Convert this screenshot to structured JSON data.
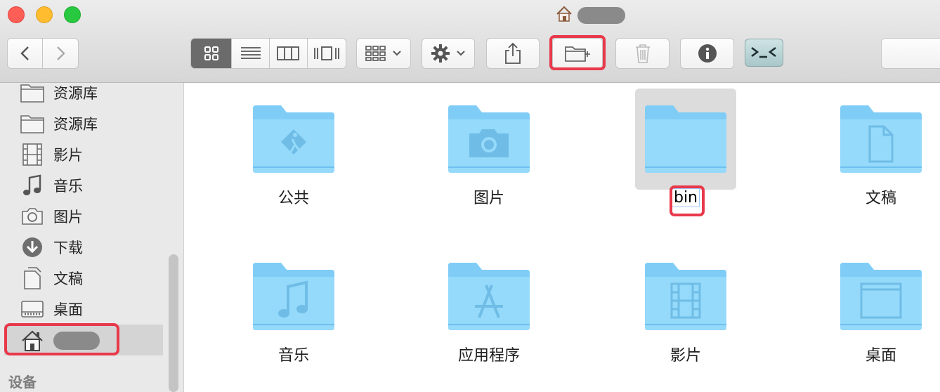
{
  "window": {
    "title_icon": "home-icon"
  },
  "toolbar": {
    "back_icon": "chevron-left-icon",
    "forward_icon": "chevron-right-icon",
    "view_modes": [
      "icon-view",
      "list-view",
      "column-view",
      "cover-flow-view"
    ],
    "active_view": "icon-view",
    "buttons": [
      "arrange-menu",
      "action-gear-menu",
      "share",
      "new-folder",
      "delete",
      "get-info",
      "terminal"
    ],
    "highlight_color": "#e8394b"
  },
  "sidebar": {
    "items": [
      {
        "label": "资源库",
        "icon": "folder-icon"
      },
      {
        "label": "资源库",
        "icon": "folder-icon"
      },
      {
        "label": "影片",
        "icon": "film-icon"
      },
      {
        "label": "音乐",
        "icon": "music-note-icon"
      },
      {
        "label": "图片",
        "icon": "camera-icon"
      },
      {
        "label": "下载",
        "icon": "download-icon"
      },
      {
        "label": "文稿",
        "icon": "document-icon"
      },
      {
        "label": "桌面",
        "icon": "desktop-icon"
      }
    ],
    "selected_icon": "home-icon",
    "section_devices": "设备"
  },
  "content": {
    "items": [
      {
        "label": "公共",
        "icon": "public-folder-icon"
      },
      {
        "label": "图片",
        "icon": "pictures-folder-icon"
      },
      {
        "label": "bin",
        "icon": "folder-icon",
        "renaming": true
      },
      {
        "label": "文稿",
        "icon": "documents-folder-icon"
      },
      {
        "label": "音乐",
        "icon": "music-folder-icon"
      },
      {
        "label": "应用程序",
        "icon": "applications-folder-icon"
      },
      {
        "label": "影片",
        "icon": "movies-folder-icon"
      },
      {
        "label": "桌面",
        "icon": "desktop-folder-icon"
      }
    ],
    "folder_color": "#7fcdf6"
  }
}
